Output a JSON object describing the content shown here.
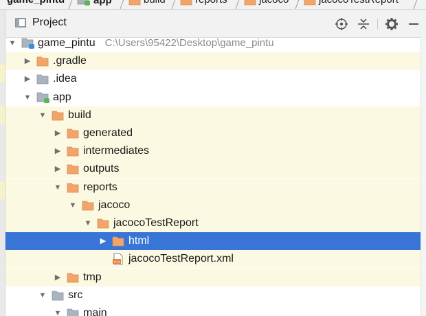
{
  "breadcrumb": [
    {
      "label": "game_pintu",
      "bold": true
    },
    {
      "label": "app",
      "bold": true
    },
    {
      "label": "build",
      "bold": false
    },
    {
      "label": "reports",
      "bold": false
    },
    {
      "label": "jacoco",
      "bold": false
    },
    {
      "label": "jacocoTestReport",
      "bold": false
    }
  ],
  "panel": {
    "title": "Project",
    "actions": [
      "locate-icon",
      "collapse-all-icon",
      "gear-icon",
      "minimize-icon"
    ]
  },
  "tree": [
    {
      "label": "game_pintu",
      "path": "C:\\Users\\95422\\Desktop\\game_pintu",
      "depth": 0,
      "expanded": true,
      "icon": "module-folder-icon",
      "highlight": false
    },
    {
      "label": ".gradle",
      "depth": 1,
      "expanded": false,
      "icon": "orange-folder-icon",
      "highlight": true
    },
    {
      "label": ".idea",
      "depth": 1,
      "expanded": false,
      "icon": "gray-folder-icon",
      "highlight": false
    },
    {
      "label": "app",
      "depth": 1,
      "expanded": true,
      "icon": "module-folder-icon",
      "highlight": false
    },
    {
      "label": "build",
      "depth": 2,
      "expanded": true,
      "icon": "orange-folder-icon",
      "highlight": true
    },
    {
      "label": "generated",
      "depth": 3,
      "expanded": false,
      "icon": "orange-folder-icon",
      "highlight": true
    },
    {
      "label": "intermediates",
      "depth": 3,
      "expanded": false,
      "icon": "orange-folder-icon",
      "highlight": true
    },
    {
      "label": "outputs",
      "depth": 3,
      "expanded": false,
      "icon": "orange-folder-icon",
      "highlight": true
    },
    {
      "label": "reports",
      "depth": 3,
      "expanded": true,
      "icon": "orange-folder-icon",
      "highlight": true
    },
    {
      "label": "jacoco",
      "depth": 4,
      "expanded": true,
      "icon": "orange-folder-icon",
      "highlight": true
    },
    {
      "label": "jacocoTestReport",
      "depth": 5,
      "expanded": true,
      "icon": "orange-folder-icon",
      "highlight": true
    },
    {
      "label": "html",
      "depth": 6,
      "expanded": false,
      "icon": "orange-folder-icon",
      "highlight": false,
      "selected": true
    },
    {
      "label": "jacocoTestReport.xml",
      "depth": 6,
      "leaf": true,
      "icon": "xml-file-icon",
      "highlight": true
    },
    {
      "label": "tmp",
      "depth": 3,
      "expanded": false,
      "icon": "orange-folder-icon",
      "highlight": true
    },
    {
      "label": "src",
      "depth": 2,
      "expanded": true,
      "icon": "gray-folder-icon",
      "highlight": false
    },
    {
      "label": "main",
      "depth": 3,
      "expanded": true,
      "icon": "gray-folder-icon",
      "highlight": false
    }
  ],
  "colors": {
    "selection": "#3875d7",
    "highlight": "#fbf9e1",
    "folder_orange": "#f1a56b",
    "folder_gray": "#a9b4be"
  }
}
